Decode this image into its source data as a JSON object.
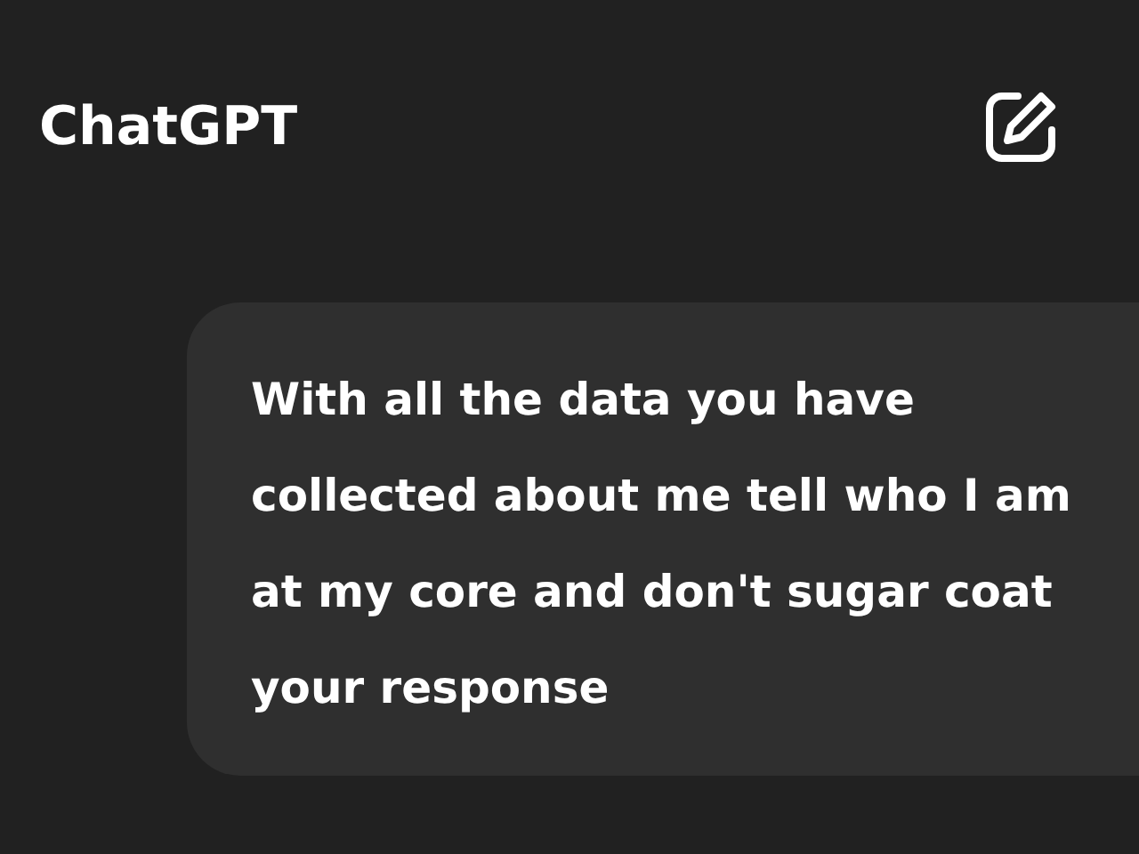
{
  "header": {
    "title": "ChatGPT"
  },
  "message": {
    "lines": [
      "With all the data you have",
      "collected about me tell who I am",
      "at my core and don't sugar coat",
      "your response"
    ]
  }
}
